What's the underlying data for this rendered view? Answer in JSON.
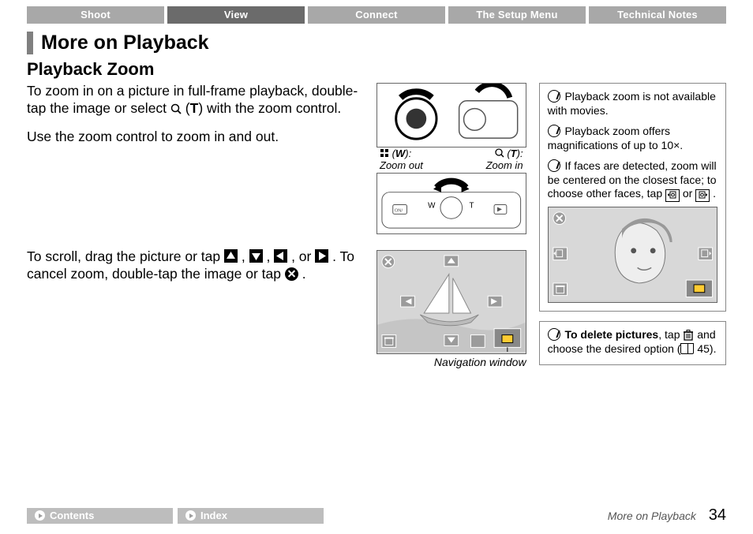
{
  "tabs": [
    "Shoot",
    "View",
    "Connect",
    "The Setup Menu",
    "Technical Notes"
  ],
  "active_tab_index": 1,
  "h1": "More on Playback",
  "h2": "Playback Zoom",
  "body": {
    "p1a": "To zoom in on a picture in full-frame playback, double-tap the image or select ",
    "p1b": " (",
    "p1c": ") with the zoom control.",
    "p2": "Use the zoom control to zoom in and out.",
    "p3a": "To scroll, drag the picture or tap ",
    "p3b": ", ",
    "p3c": ", ",
    "p3d": ", or ",
    "p3e": ". To cancel zoom, double-tap the image or tap ",
    "p3f": "."
  },
  "mid": {
    "zoom_out_symbol_w": "W",
    "zoom_in_symbol_t": "T",
    "zoom_out_label": "Zoom out",
    "zoom_in_label": "Zoom in",
    "nav_label": "Navigation window"
  },
  "notes": {
    "n1": " Playback zoom is not available with movies.",
    "n2": " Playback zoom offers magnifications of up to 10×.",
    "n3a": " If faces are detected, zoom will be centered on the closest face; to choose other faces, tap ",
    "n3b": " or ",
    "n3c": ".",
    "delete_bold": "To delete pictures",
    "delete_a": ", tap ",
    "delete_b": " and choose the desired option (",
    "delete_c": " 45)."
  },
  "footer": {
    "contents": "Contents",
    "index": "Index",
    "section": "More on Playback",
    "page": "34"
  }
}
